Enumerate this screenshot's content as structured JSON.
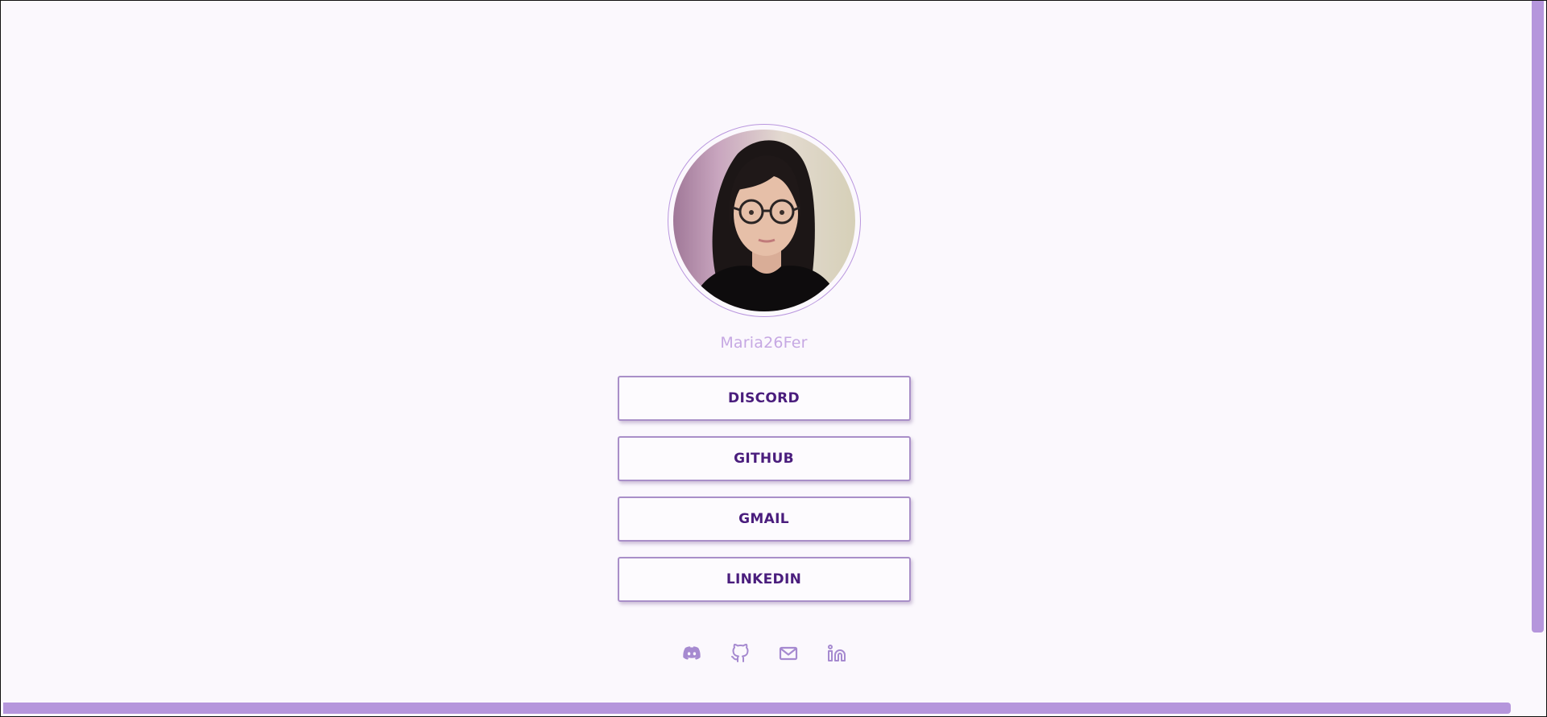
{
  "profile": {
    "username": "Maria26Fer",
    "avatar_alt": "profile photo"
  },
  "links": [
    {
      "label": "DISCORD"
    },
    {
      "label": "GITHUB"
    },
    {
      "label": "GMAIL"
    },
    {
      "label": "LINKEDIN"
    }
  ],
  "social_icons": [
    "discord-icon",
    "github-icon",
    "gmail-icon",
    "linkedin-icon"
  ],
  "colors": {
    "background": "#fbf8fd",
    "accent": "#b596dc",
    "button_text": "#4a1d7d",
    "username": "#c6a8e3",
    "icon": "#a68ad0"
  }
}
